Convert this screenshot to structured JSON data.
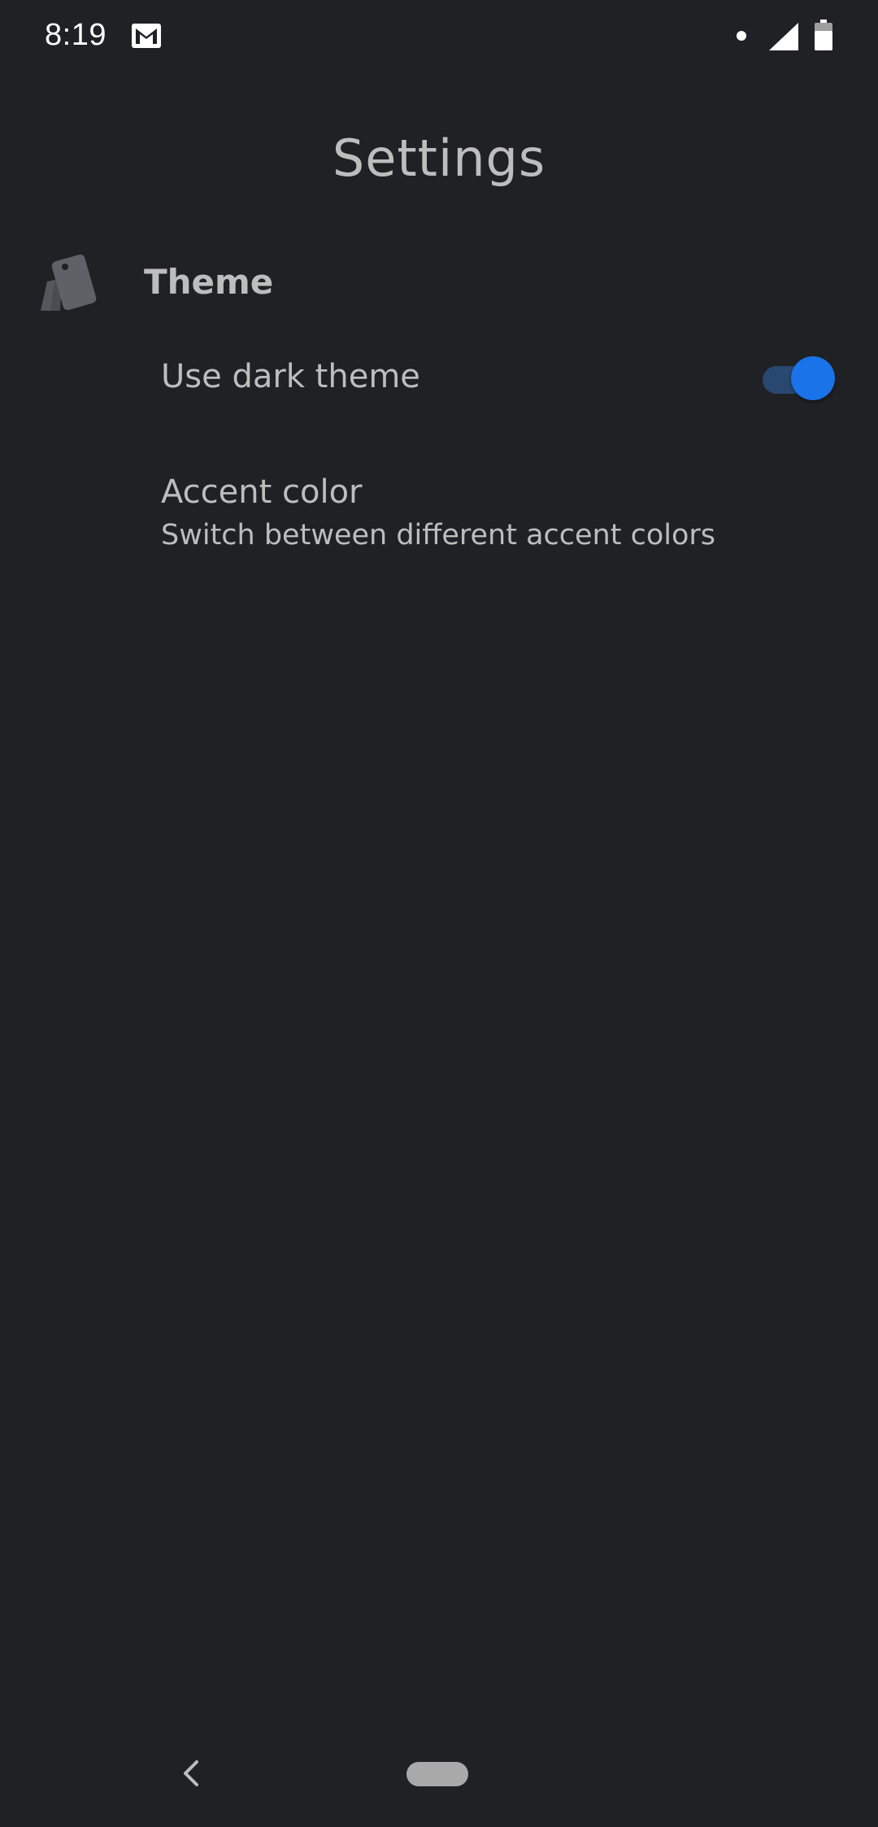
{
  "status_bar": {
    "time": "8:19",
    "icons": [
      "gmail-icon",
      "notification-dot-icon",
      "cell-signal-icon",
      "battery-icon"
    ]
  },
  "header": {
    "title": "Settings"
  },
  "sections": [
    {
      "title": "Theme",
      "icon": "palette-swatch-icon",
      "items": [
        {
          "title": "Use dark theme",
          "type": "switch",
          "checked": true
        },
        {
          "title": "Accent color",
          "summary": "Switch between different accent colors",
          "type": "preference"
        }
      ]
    }
  ],
  "nav_bar": {
    "icons": [
      "back-icon",
      "home-pill-icon"
    ]
  },
  "colors": {
    "background": "#202125",
    "text": "#bdbdbd",
    "accent": "#1a73e8",
    "switch_track": "#284870"
  }
}
